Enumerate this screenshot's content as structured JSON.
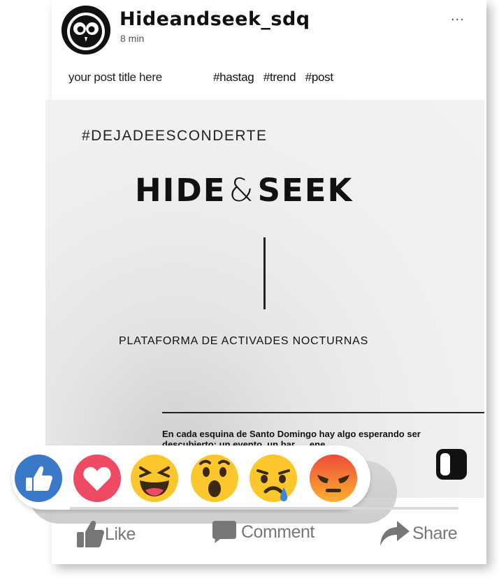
{
  "post": {
    "username": "Hideandseek_sdq",
    "time": "8 min",
    "more_label": "...",
    "title": "your post title here",
    "hashtags": [
      "#hastag",
      "#trend",
      "#post"
    ]
  },
  "image": {
    "hashtag": "#DEJADEESCONDERTE",
    "logo_left": "HIDE",
    "logo_amp": "&",
    "logo_right": "SEEK",
    "tagline": "PLATAFORMA DE ACTIVADES NOCTURNAS",
    "description": "En cada esquina de Santo Domingo hay algo esperando ser descubierto: un evento, un bar, ... ene."
  },
  "reactions": [
    {
      "name": "like",
      "color": "#3b79c8"
    },
    {
      "name": "love",
      "color": "#ef4a63"
    },
    {
      "name": "haha",
      "color": "#fbc72d"
    },
    {
      "name": "wow",
      "color": "#fbc72d"
    },
    {
      "name": "sad",
      "color": "#fbc72d"
    },
    {
      "name": "angry",
      "color": "#ef6a36"
    }
  ],
  "actions": {
    "like": "Like",
    "comment": "Comment",
    "share": "Share"
  },
  "colors": {
    "action_gray": "#777777",
    "accent_blue": "#3b79c8"
  }
}
